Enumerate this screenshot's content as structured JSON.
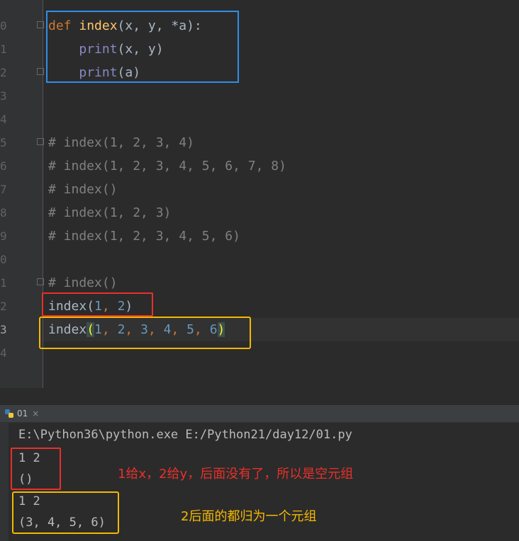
{
  "editor": {
    "line_numbers": [
      "0",
      "1",
      "2",
      "3",
      "4",
      "5",
      "6",
      "7",
      "8",
      "9",
      "0",
      "1",
      "2",
      "3",
      "4"
    ],
    "code": {
      "def_kw": "def",
      "def_name": "index",
      "def_params": "(x, y, *a):",
      "line1_print": "print",
      "line1_args": "(x, y)",
      "line2_print": "print",
      "line2_args": "(a)",
      "comment1": "# index(1, 2, 3, 4)",
      "comment2": "# index(1, 2, 3, 4, 5, 6, 7, 8)",
      "comment3": "# index()",
      "comment4": "# index(1, 2, 3)",
      "comment5": "# index(1, 2, 3, 4, 5, 6)",
      "comment6": "# index()",
      "call1_name": "index",
      "call1_open": "(",
      "call1_arg1": "1",
      "call1_sep": ", ",
      "call1_arg2": "2",
      "call1_close": ")",
      "call2_name": "index",
      "call2_open": "(",
      "call2_args": [
        "1",
        "2",
        "3",
        "4",
        "5",
        "6"
      ],
      "call2_sep": ", ",
      "call2_close": ")"
    }
  },
  "run_panel": {
    "tab_label": "01",
    "tab_close": "×"
  },
  "console": {
    "command": "E:\\Python36\\python.exe E:/Python21/day12/01.py",
    "out1": "1 2",
    "out2": "()",
    "out3": "1 2",
    "out4": "(3, 4, 5, 6)"
  },
  "annotations": {
    "red_note": "1给x，2给y，后面没有了，所以是空元组",
    "yellow_note": "2后面的都归为一个元组"
  },
  "colors": {
    "blue_box": "#2f8fe8",
    "red_box": "#e8302a",
    "yellow_box": "#f5b800",
    "red_text": "#e8302a",
    "yellow_text": "#f5b800"
  }
}
